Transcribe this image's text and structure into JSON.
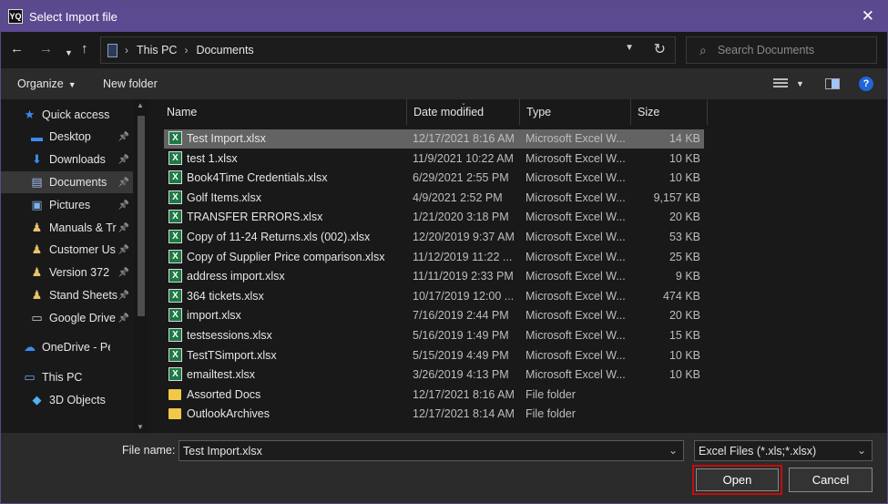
{
  "window": {
    "app_icon_text": "YQ",
    "title": "Select Import file",
    "close_glyph": "✕"
  },
  "nav": {
    "address": {
      "root": "This PC",
      "folder": "Documents"
    },
    "search_placeholder": "Search Documents"
  },
  "toolbar": {
    "organize": "Organize",
    "new_folder": "New folder",
    "help": "?"
  },
  "sidebar": {
    "items": [
      {
        "label": "Quick access",
        "icon": "star-icon",
        "pinned": false,
        "selected": false
      },
      {
        "label": "Desktop",
        "icon": "desktop-icon",
        "pinned": true,
        "selected": false
      },
      {
        "label": "Downloads",
        "icon": "download-icon",
        "pinned": true,
        "selected": false
      },
      {
        "label": "Documents",
        "icon": "documents-icon",
        "pinned": true,
        "selected": true
      },
      {
        "label": "Pictures",
        "icon": "pictures-icon",
        "pinned": true,
        "selected": false
      },
      {
        "label": "Manuals & Tr",
        "icon": "user-folder-icon",
        "pinned": true,
        "selected": false
      },
      {
        "label": "Customer Us",
        "icon": "user-folder-icon",
        "pinned": true,
        "selected": false
      },
      {
        "label": "Version 372",
        "icon": "user-folder-icon",
        "pinned": true,
        "selected": false
      },
      {
        "label": "Stand Sheets",
        "icon": "user-folder-icon",
        "pinned": true,
        "selected": false
      },
      {
        "label": "Google Drive",
        "icon": "drive-icon",
        "pinned": true,
        "selected": false
      },
      {
        "label": "OneDrive - Persor",
        "icon": "cloud-icon",
        "pinned": false,
        "selected": false
      },
      {
        "label": "This PC",
        "icon": "computer-icon",
        "pinned": false,
        "selected": false
      },
      {
        "label": "3D Objects",
        "icon": "cube-icon",
        "pinned": false,
        "selected": false
      }
    ]
  },
  "columns": {
    "name": "Name",
    "date": "Date modified",
    "type": "Type",
    "size": "Size"
  },
  "files": [
    {
      "name": "Test Import.xlsx",
      "date": "12/17/2021 8:16 AM",
      "type": "Microsoft Excel W...",
      "size": "14 KB",
      "kind": "excel",
      "selected": true
    },
    {
      "name": "test 1.xlsx",
      "date": "11/9/2021 10:22 AM",
      "type": "Microsoft Excel W...",
      "size": "10 KB",
      "kind": "excel"
    },
    {
      "name": "Book4Time Credentials.xlsx",
      "date": "6/29/2021 2:55 PM",
      "type": "Microsoft Excel W...",
      "size": "10 KB",
      "kind": "excel"
    },
    {
      "name": "Golf Items.xlsx",
      "date": "4/9/2021 2:52 PM",
      "type": "Microsoft Excel W...",
      "size": "9,157 KB",
      "kind": "excel"
    },
    {
      "name": "TRANSFER ERRORS.xlsx",
      "date": "1/21/2020 3:18 PM",
      "type": "Microsoft Excel W...",
      "size": "20 KB",
      "kind": "excel"
    },
    {
      "name": "Copy of 11-24 Returns.xls (002).xlsx",
      "date": "12/20/2019 9:37 AM",
      "type": "Microsoft Excel W...",
      "size": "53 KB",
      "kind": "excel"
    },
    {
      "name": "Copy of Supplier Price comparison.xlsx",
      "date": "11/12/2019 11:22 ...",
      "type": "Microsoft Excel W...",
      "size": "25 KB",
      "kind": "excel"
    },
    {
      "name": "address import.xlsx",
      "date": "11/11/2019 2:33 PM",
      "type": "Microsoft Excel W...",
      "size": "9 KB",
      "kind": "excel"
    },
    {
      "name": "364 tickets.xlsx",
      "date": "10/17/2019 12:00 ...",
      "type": "Microsoft Excel W...",
      "size": "474 KB",
      "kind": "excel"
    },
    {
      "name": "import.xlsx",
      "date": "7/16/2019 2:44 PM",
      "type": "Microsoft Excel W...",
      "size": "20 KB",
      "kind": "excel"
    },
    {
      "name": "testsessions.xlsx",
      "date": "5/16/2019 1:49 PM",
      "type": "Microsoft Excel W...",
      "size": "15 KB",
      "kind": "excel"
    },
    {
      "name": "TestTSimport.xlsx",
      "date": "5/15/2019 4:49 PM",
      "type": "Microsoft Excel W...",
      "size": "10 KB",
      "kind": "excel"
    },
    {
      "name": "emailtest.xlsx",
      "date": "3/26/2019 4:13 PM",
      "type": "Microsoft Excel W...",
      "size": "10 KB",
      "kind": "excel"
    },
    {
      "name": "Assorted Docs",
      "date": "12/17/2021 8:16 AM",
      "type": "File folder",
      "size": "",
      "kind": "folder"
    },
    {
      "name": "OutlookArchives",
      "date": "12/17/2021 8:14 AM",
      "type": "File folder",
      "size": "",
      "kind": "folder"
    }
  ],
  "footer": {
    "file_name_label": "File name:",
    "file_name_value": "Test Import.xlsx",
    "filter": "Excel Files (*.xls;*.xlsx)",
    "open": "Open",
    "cancel": "Cancel"
  },
  "colors": {
    "titlebar": "#5c4a91",
    "selection": "#636363",
    "excel": "#1e7a45",
    "folder": "#f2c84b",
    "open_highlight": "#c40d0d"
  }
}
